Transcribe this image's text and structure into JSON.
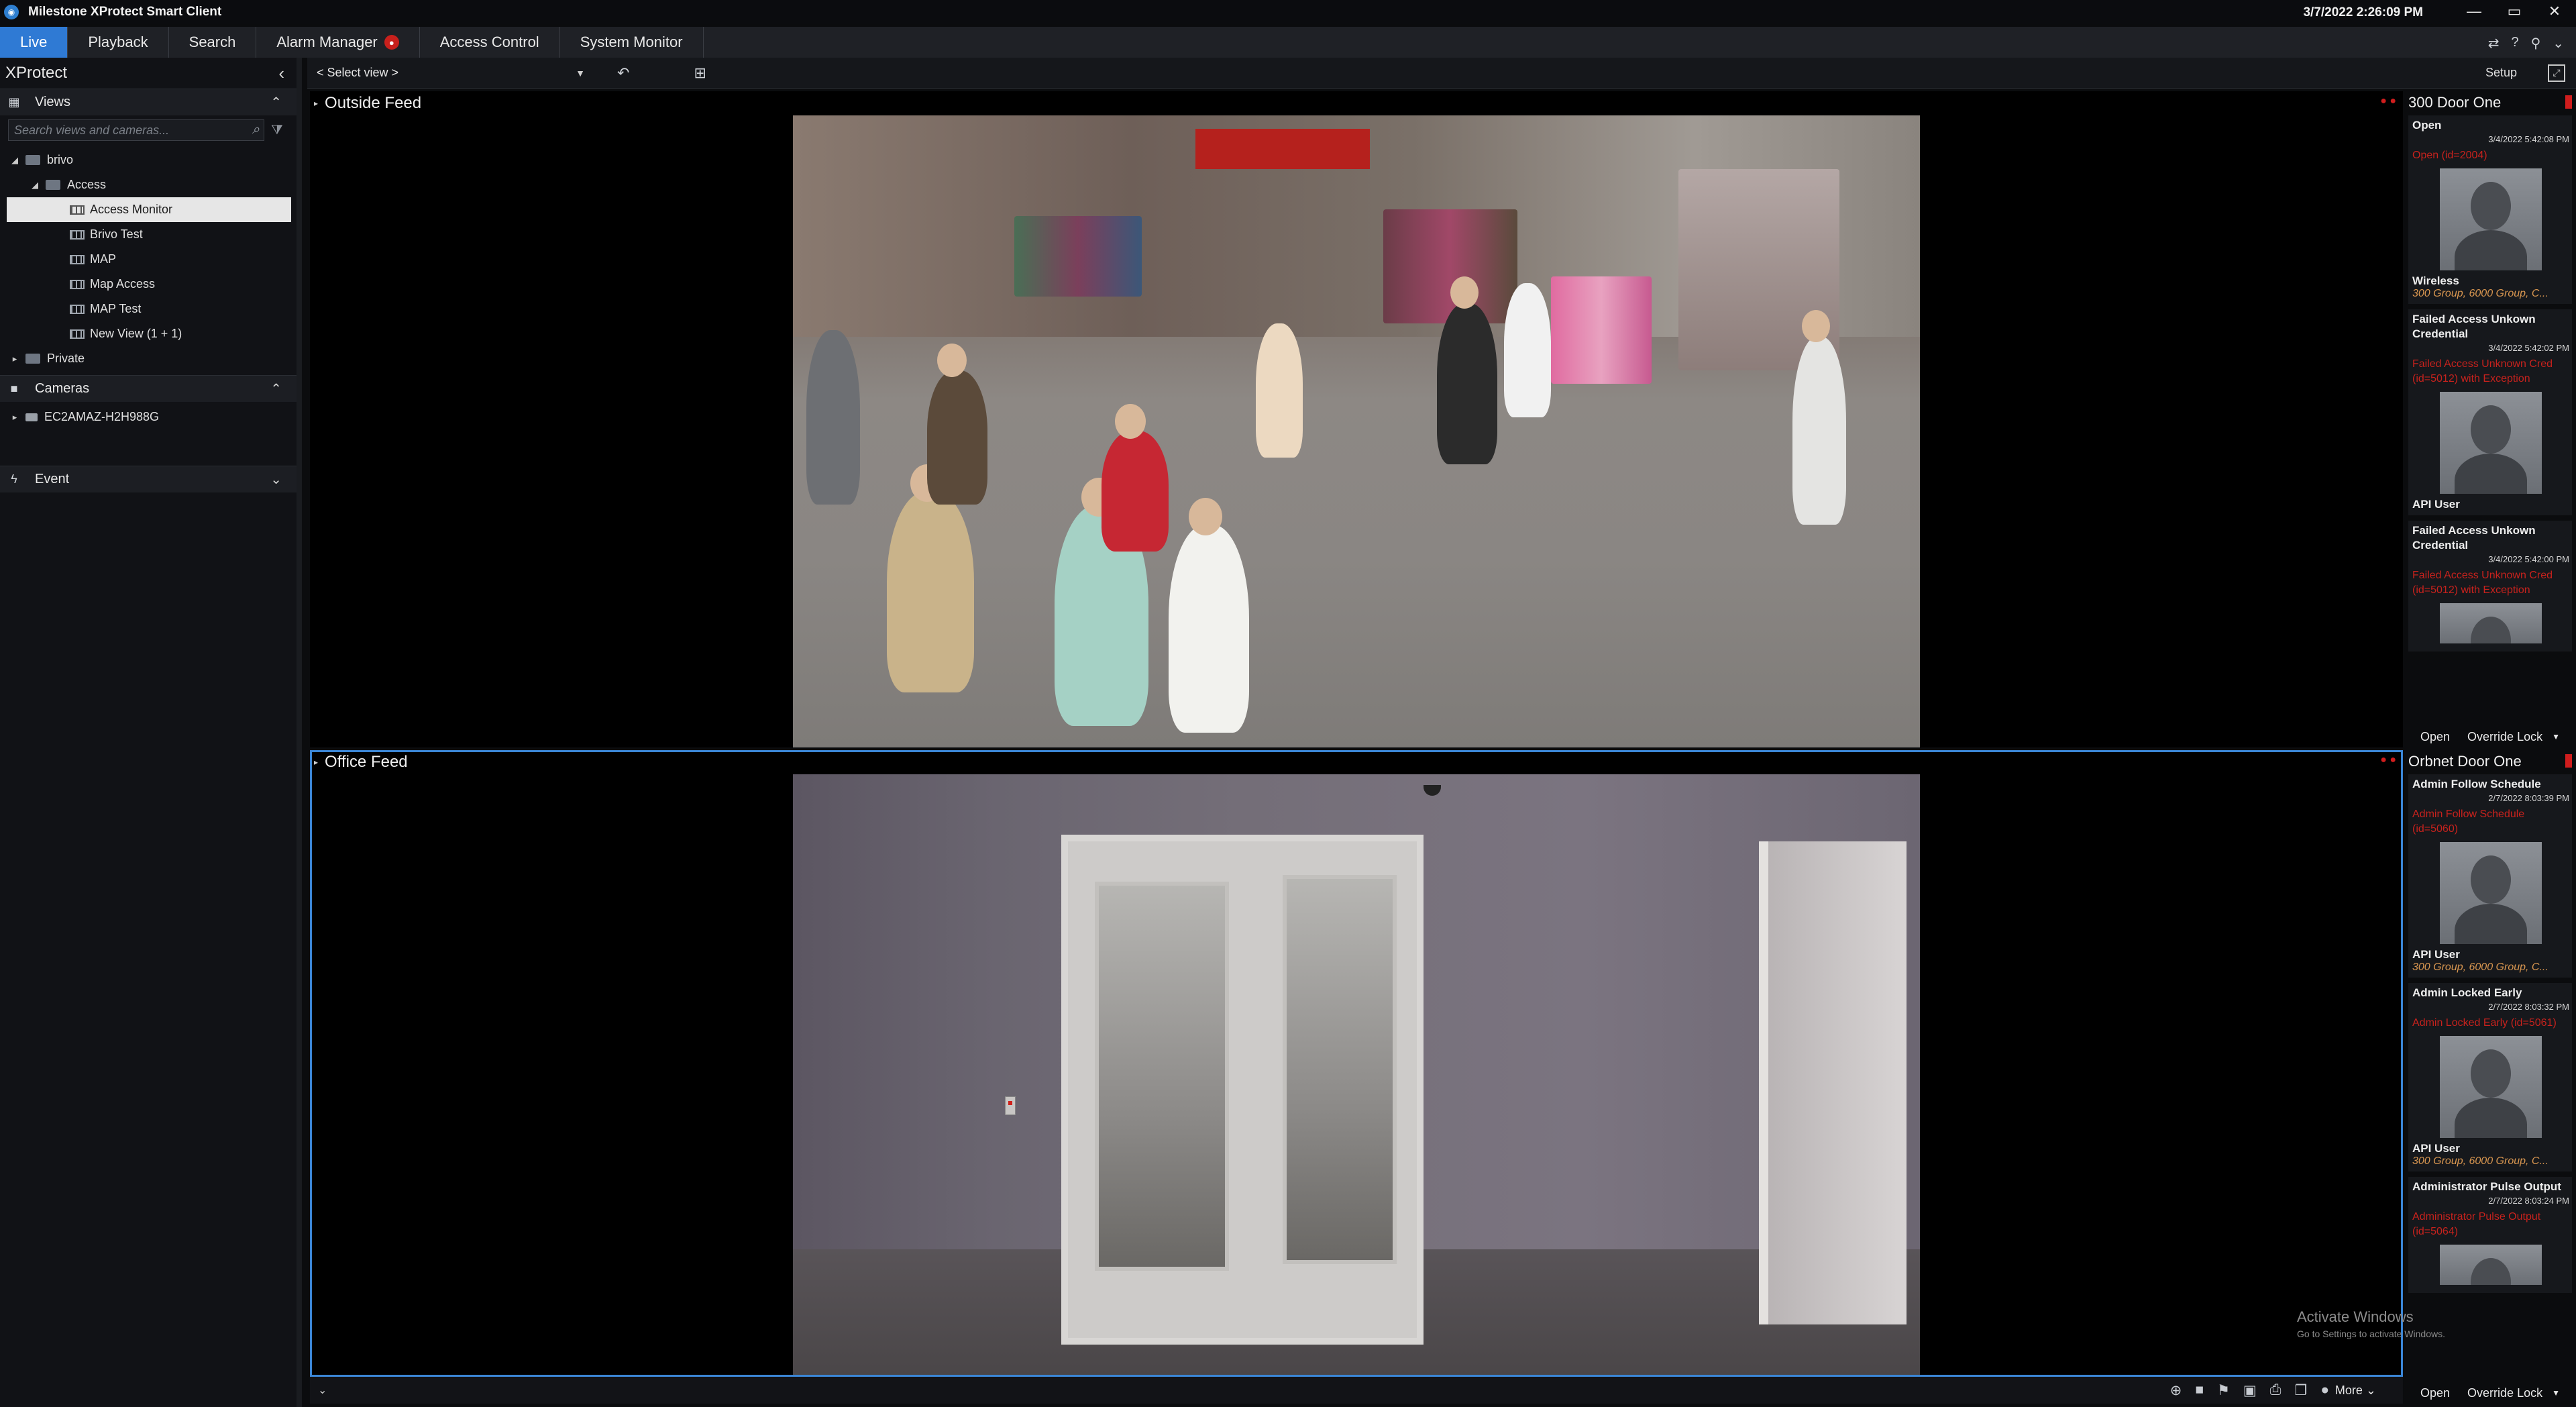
{
  "window": {
    "title": "Milestone XProtect Smart Client",
    "clock": "3/7/2022 2:26:09 PM"
  },
  "nav": {
    "tabs": [
      "Live",
      "Playback",
      "Search",
      "Alarm Manager",
      "Access Control",
      "System Monitor"
    ],
    "active": "Live"
  },
  "left": {
    "brand": "XProtect",
    "views_label": "Views",
    "search_placeholder": "Search views and cameras...",
    "tree": {
      "root": "brivo",
      "access_group": "Access",
      "views": [
        "Access Monitor",
        "Brivo Test",
        "MAP",
        "Map Access",
        "MAP Test",
        "New View (1 + 1)"
      ],
      "private": "Private"
    },
    "cameras_label": "Cameras",
    "camera_host": "EC2AMAZ-H2H988G",
    "event_label": "Event"
  },
  "viewbar": {
    "select_view": "< Select view >",
    "setup": "Setup"
  },
  "panes": {
    "top_title": "Outside Feed",
    "bottom_title": "Office Feed"
  },
  "side_top": {
    "door": "300 Door One",
    "events": [
      {
        "title": "Open",
        "time": "3/4/2022 5:42:08 PM",
        "detail": "Open (id=2004)",
        "user": "Wireless",
        "groups": "300 Group, 6000 Group, C..."
      },
      {
        "title": "Failed Access Unkown Credential",
        "time": "3/4/2022 5:42:02 PM",
        "detail": "Failed Access Unknown Cred (id=5012) with Exception",
        "user": "API User",
        "groups": ""
      },
      {
        "title": "Failed Access Unkown Credential",
        "time": "3/4/2022 5:42:00 PM",
        "detail": "Failed Access Unknown Cred (id=5012) with Exception",
        "user": "",
        "groups": ""
      }
    ],
    "actions": {
      "open": "Open",
      "override": "Override Lock"
    }
  },
  "side_bottom": {
    "door": "Orbnet Door One",
    "events": [
      {
        "title": "Admin Follow Schedule",
        "time": "2/7/2022 8:03:39 PM",
        "detail": "Admin Follow Schedule (id=5060)",
        "user": "API User",
        "groups": "300 Group, 6000 Group, C..."
      },
      {
        "title": "Admin Locked Early",
        "time": "2/7/2022 8:03:32 PM",
        "detail": "Admin Locked Early (id=5061)",
        "user": "API User",
        "groups": "300 Group, 6000 Group, C..."
      },
      {
        "title": "Administrator Pulse Output",
        "time": "2/7/2022 8:03:24 PM",
        "detail": "Administrator Pulse Output (id=5064)",
        "user": "",
        "groups": ""
      }
    ],
    "actions": {
      "open": "Open",
      "override": "Override Lock"
    }
  },
  "bottombar": {
    "more": "More"
  },
  "watermark": {
    "line1": "Activate Windows",
    "line2": "Go to Settings to activate Windows."
  }
}
